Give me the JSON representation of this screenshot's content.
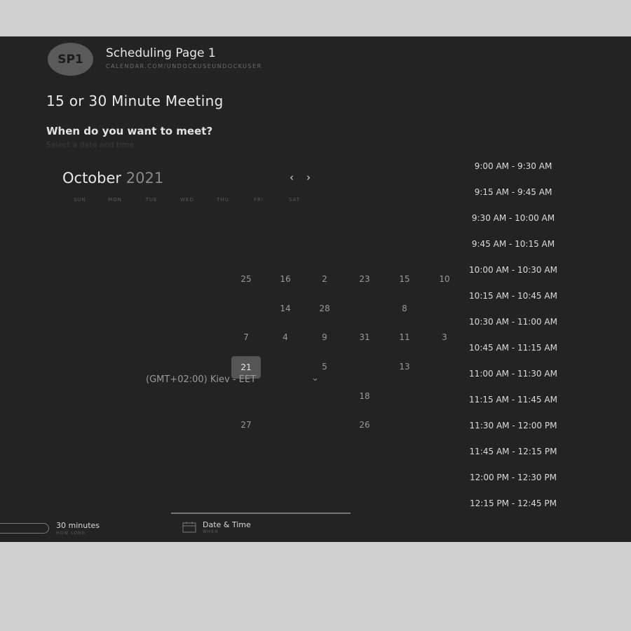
{
  "header": {
    "avatar_initials": "SP1",
    "page_name": "Scheduling Page 1",
    "url": "CALENDAR.COM/UNDOCKUSEUNDOCKUSER"
  },
  "meeting": {
    "title": "15 or 30 Minute Meeting",
    "question": "When do you want to meet?",
    "subtitle": "Select a date and time"
  },
  "calendar": {
    "month": "October",
    "year": "2021",
    "prev_icon": "‹",
    "next_icon": "›",
    "weekdays": [
      "SUN",
      "MON",
      "TUE",
      "WED",
      "THU",
      "FRI",
      "SAT"
    ],
    "days": [
      "25",
      "16",
      "2",
      "23",
      "15",
      "10",
      "14",
      "28",
      "8",
      "7",
      "4",
      "9",
      "31",
      "11",
      "3",
      "21",
      "5",
      "13",
      "18",
      "27",
      "26"
    ],
    "selected_day": "21",
    "timezone": "(GMT+02:00) Kiev - EET",
    "timezone_chevron": "⌄"
  },
  "time_slots": [
    "9:00 AM - 9:30 AM",
    "9:15 AM - 9:45 AM",
    "9:30 AM - 10:00 AM",
    "9:45 AM - 10:15 AM",
    "10:00 AM - 10:30 AM",
    "10:15 AM - 10:45 AM",
    "10:30 AM - 11:00 AM",
    "10:45 AM - 11:15 AM",
    "11:00 AM - 11:30 AM",
    "11:15 AM - 11:45 AM",
    "11:30 AM - 12:00 PM",
    "11:45 AM - 12:15 PM",
    "12:00 PM - 12:30 PM",
    "12:15 PM - 12:45 PM"
  ],
  "footer": {
    "duration_value": "30 minutes",
    "duration_label": "HOW LONG",
    "datetime_value": "Date & Time",
    "datetime_label": "WHEN"
  },
  "icons": {
    "calendar": "calendar-icon",
    "prev": "chevron-left-icon",
    "next": "chevron-right-icon",
    "timezone": "chevron-down-icon"
  }
}
